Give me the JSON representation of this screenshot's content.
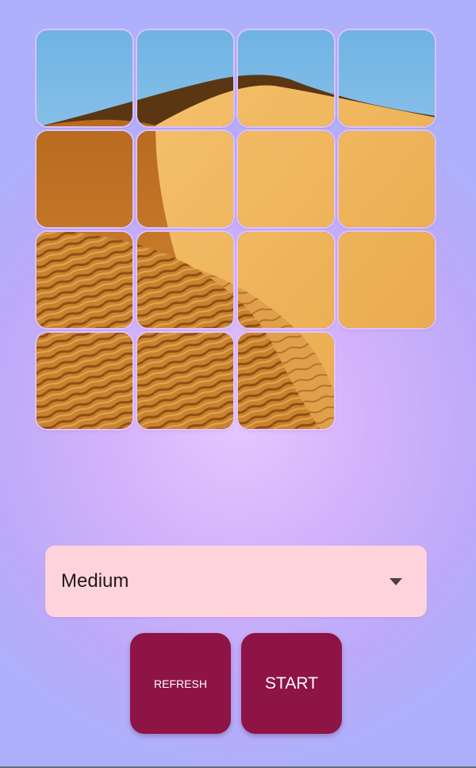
{
  "puzzle": {
    "grid_size": 4,
    "tiles": [
      {
        "col": 0,
        "row": 0
      },
      {
        "col": 1,
        "row": 0
      },
      {
        "col": 2,
        "row": 0
      },
      {
        "col": 3,
        "row": 0
      },
      {
        "col": 0,
        "row": 1
      },
      {
        "col": 1,
        "row": 1
      },
      {
        "col": 2,
        "row": 1
      },
      {
        "col": 3,
        "row": 1
      },
      {
        "col": 0,
        "row": 2
      },
      {
        "col": 1,
        "row": 2
      },
      {
        "col": 2,
        "row": 2
      },
      {
        "col": 3,
        "row": 2
      },
      {
        "col": 0,
        "row": 3
      },
      {
        "col": 1,
        "row": 3
      },
      {
        "col": 2,
        "row": 3
      }
    ],
    "empty_slot": {
      "col": 3,
      "row": 3
    },
    "image": "desert-sand-dune"
  },
  "difficulty": {
    "selected": "Medium",
    "caret_icon": "caret-down-icon"
  },
  "buttons": {
    "refresh_label": "REFRESH",
    "start_label": "START"
  },
  "colors": {
    "button_bg": "#8e1446",
    "dropdown_bg": "#ffd3dc",
    "background_center": "#e6c6ff",
    "background_edge": "#aeb0fb"
  }
}
